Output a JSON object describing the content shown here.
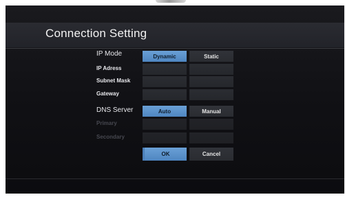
{
  "window": {
    "title": "Connection Setting"
  },
  "fields": {
    "ip_mode": {
      "label": "IP Mode",
      "options": [
        "Dynamic",
        "Static"
      ],
      "selected": "Dynamic"
    },
    "ip_address": {
      "label": "IP Adress"
    },
    "subnet_mask": {
      "label": "Subnet Mask"
    },
    "gateway": {
      "label": "Gateway"
    },
    "dns_server": {
      "label": "DNS Server",
      "options": [
        "Auto",
        "Manual"
      ],
      "selected": "Auto"
    },
    "primary": {
      "label": "Primary"
    },
    "secondary": {
      "label": "Secondary"
    }
  },
  "buttons": {
    "ok": "OK",
    "cancel": "Cancel"
  },
  "colors": {
    "background": "#111115",
    "selected": "#5a91cc",
    "cell": "#2e3035",
    "text": "#e8e8ec",
    "disabled_text": "#474850"
  }
}
